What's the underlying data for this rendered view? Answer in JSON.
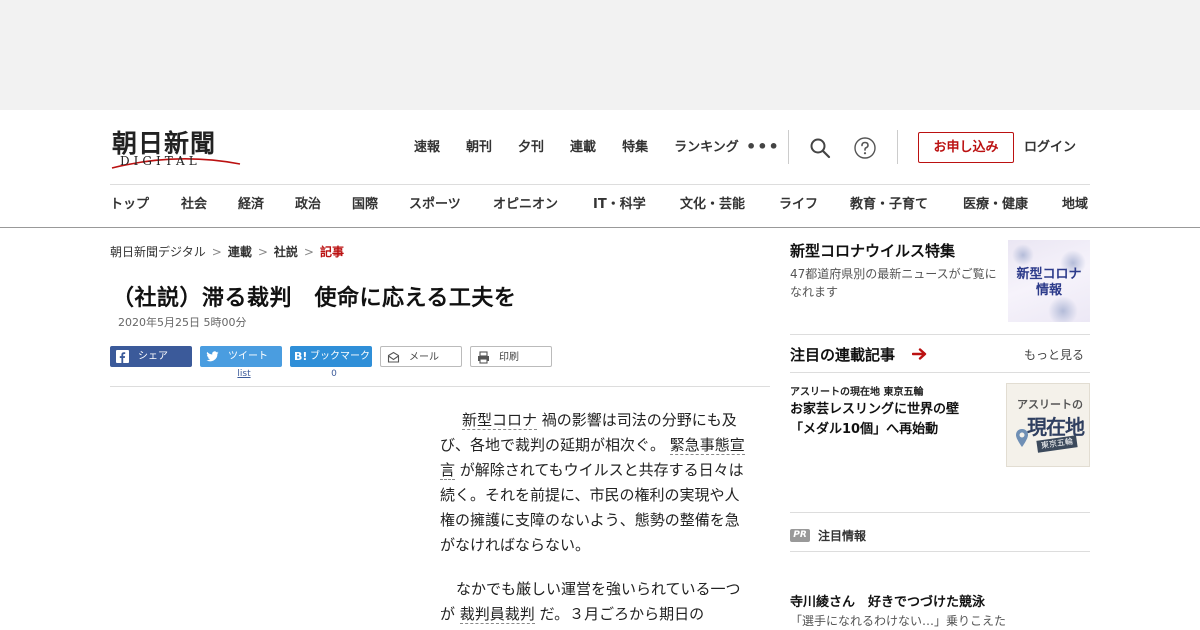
{
  "header": {
    "logo_main": "朝日新聞",
    "logo_sub": "DIGITAL",
    "top_nav": [
      "速報",
      "朝刊",
      "夕刊",
      "連載",
      "特集",
      "ランキング"
    ],
    "more": "•••",
    "apply_label": "お申し込み",
    "login_label": "ログイン",
    "accent": "#b11111"
  },
  "category_nav": [
    "トップ",
    "社会",
    "経済",
    "政治",
    "国際",
    "スポーツ",
    "オピニオン",
    "IT・科学",
    "文化・芸能",
    "ライフ",
    "教育・子育て",
    "医療・健康",
    "地域"
  ],
  "breadcrumb": [
    "朝日新聞デジタル",
    "連載",
    "社説",
    "記事"
  ],
  "breadcrumb_sep": ">",
  "article": {
    "title": "（社説）滞る裁判　使命に応える工夫を",
    "date": "2020年5月25日 5時00分",
    "share": {
      "facebook": "シェア",
      "twitter": "ツイート",
      "hatena_icon": "B!",
      "hatena": "ブックマーク",
      "mail": "メール",
      "print": "印刷",
      "twitter_count": "list",
      "hatena_count": "0"
    },
    "p1_kw1": "新型コロナ",
    "p1_a": "禍の影響は司法の分野にも及び、各地で裁判の延期が相次ぐ。",
    "p1_kw2": "緊急事態宣言",
    "p1_b": "が解除されてもウイルスと共存する日々は続く。それを前提に、市民の権利の実現や人権の擁護に支障のないよう、態勢の整備を急がなければならない。",
    "p2_a": "なかでも厳しい運営を強いられている一つが",
    "p2_kw": "裁判員裁判",
    "p2_b": "だ。３月ごろから期日の"
  },
  "sidebar": {
    "feature": {
      "title": "新型コロナウイルス特集",
      "desc": "47都道府県別の最新ニュースがご覧になれます",
      "thumb_line1": "新型コロナ",
      "thumb_line2": "情報"
    },
    "series": {
      "title": "注目の連載記事",
      "more": "もっと見る",
      "category": "アスリートの現在地 東京五輪",
      "headline_l1": "お家芸レスリングに世界の壁",
      "headline_l2": "「メダル10個」へ再始動",
      "thumb_l1": "アスリートの",
      "thumb_l2": "現在地",
      "thumb_badge": "東京五輪"
    },
    "pr": {
      "badge": "PR",
      "label": "注目情報",
      "headline": "寺川綾さん　好きでつづけた競泳",
      "sub": "「選手になれるわけない…」乗りこえた"
    }
  }
}
